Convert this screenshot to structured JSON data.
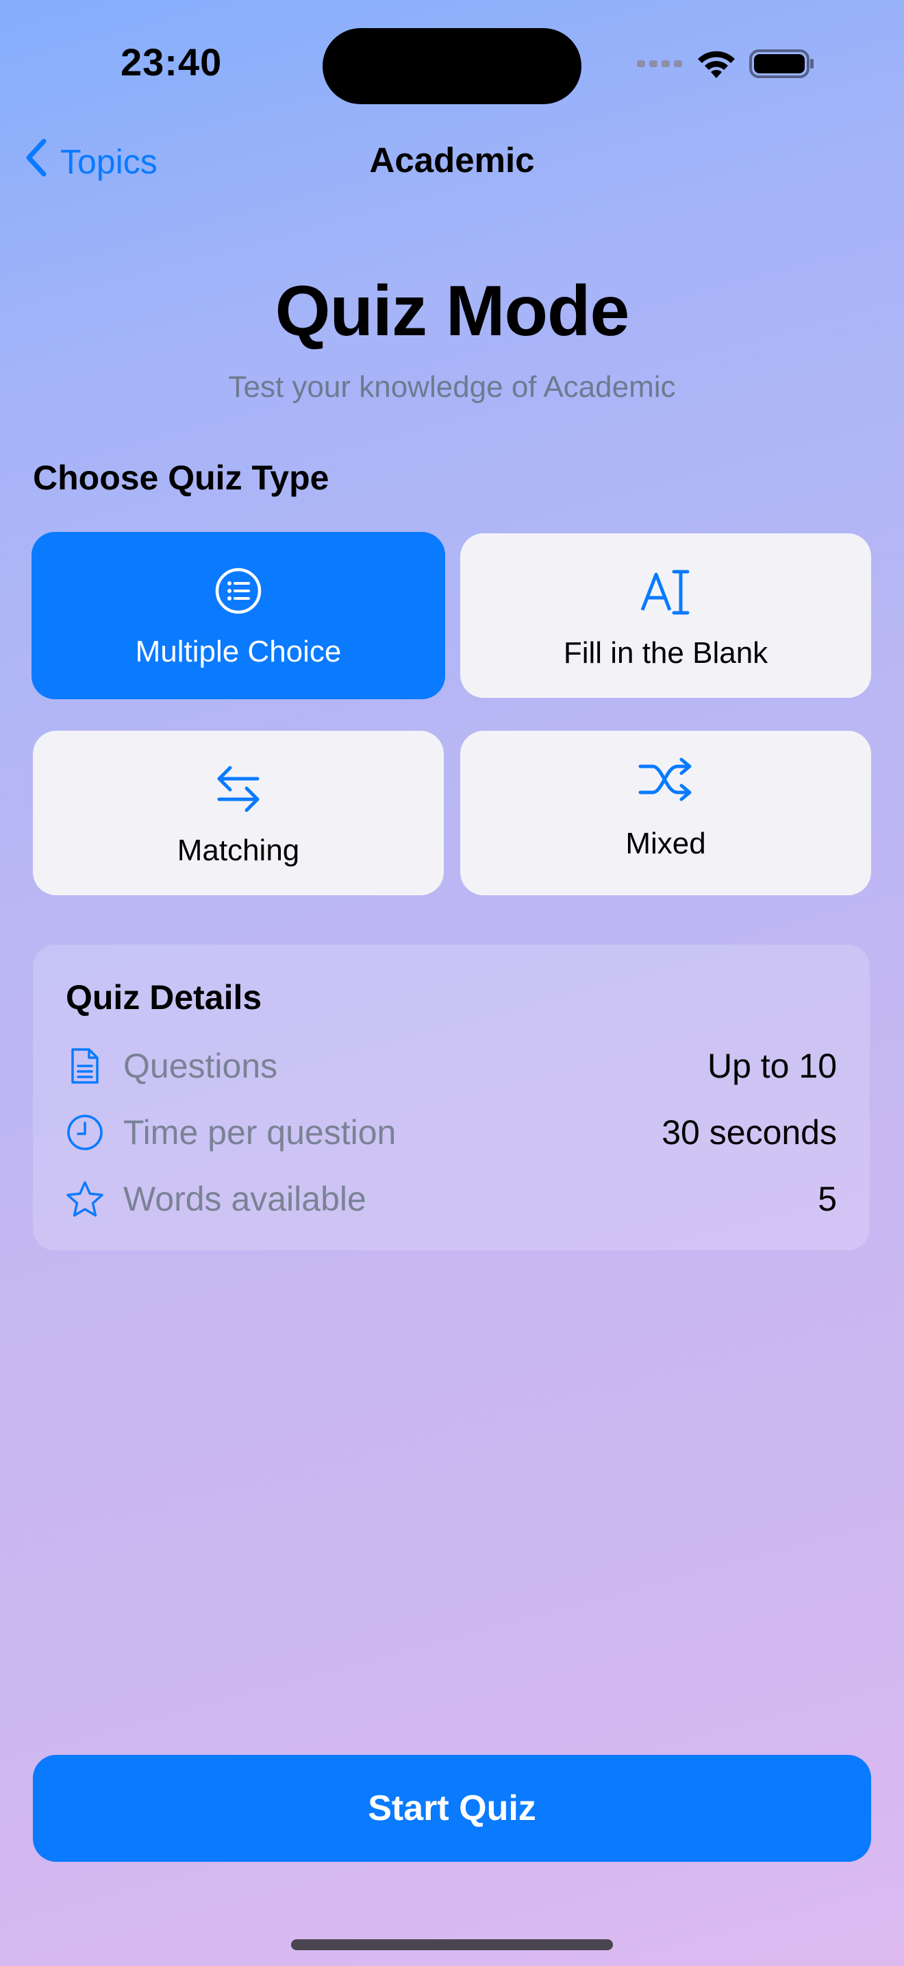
{
  "status_bar": {
    "time": "23:40",
    "signal_icon": "cellular-dots-icon",
    "wifi_icon": "wifi-icon",
    "battery_icon": "battery-icon"
  },
  "nav": {
    "back_label": "Topics",
    "back_icon": "chevron-left-icon",
    "title": "Academic"
  },
  "header": {
    "title": "Quiz Mode",
    "subtitle": "Test your knowledge of Academic"
  },
  "quiz_types": {
    "section_title": "Choose Quiz Type",
    "selected": "Multiple Choice",
    "items": [
      {
        "label": "Multiple Choice",
        "icon": "list-bullet-circle-icon"
      },
      {
        "label": "Fill in the Blank",
        "icon": "text-cursor-icon"
      },
      {
        "label": "Matching",
        "icon": "arrows-left-right-icon"
      },
      {
        "label": "Mixed",
        "icon": "shuffle-icon"
      }
    ]
  },
  "details": {
    "title": "Quiz Details",
    "rows": [
      {
        "label": "Questions",
        "value": "Up to 10",
        "icon": "document-icon"
      },
      {
        "label": "Time per question",
        "value": "30 seconds",
        "icon": "clock-icon"
      },
      {
        "label": "Words available",
        "value": "5",
        "icon": "star-icon"
      }
    ]
  },
  "actions": {
    "start_label": "Start Quiz"
  },
  "colors": {
    "accent": "#0A7AFF",
    "card_bg": "#F3F3F7",
    "secondary_text": "#7A8296"
  }
}
